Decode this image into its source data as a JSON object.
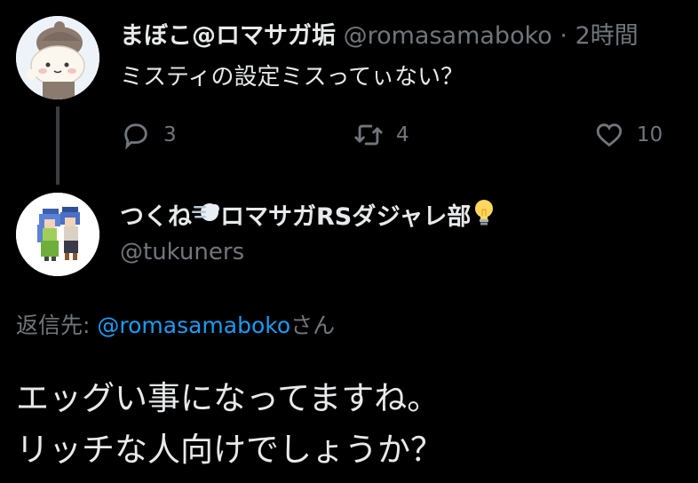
{
  "parent": {
    "display_name": "まぼこ@ロマサガ垢",
    "handle": "@romasamaboko",
    "dot": "·",
    "time": "2時間",
    "text": "ミスティの設定ミスってぃない？",
    "actions": {
      "replies": "3",
      "retweets": "4",
      "likes": "10"
    }
  },
  "reply": {
    "display_name_prefix": "つくね",
    "display_name_middle": "ロマサガRSダジャレ部",
    "handle": "@tukuners",
    "replying_prefix": "返信先: ",
    "replying_mention": "@romasamaboko",
    "replying_suffix": "さん",
    "text_lines": [
      "エッグい事になってますね。",
      "リッチな人向けでしょうか？"
    ]
  },
  "colors": {
    "background": "#000000",
    "text": "#e7e9ea",
    "muted": "#71767b",
    "link": "#1d9bf0",
    "thread_line": "#3a3e42"
  },
  "icons": [
    "reply-icon",
    "retweet-icon",
    "like-icon",
    "dash-emoji",
    "lightbulb-emoji"
  ]
}
